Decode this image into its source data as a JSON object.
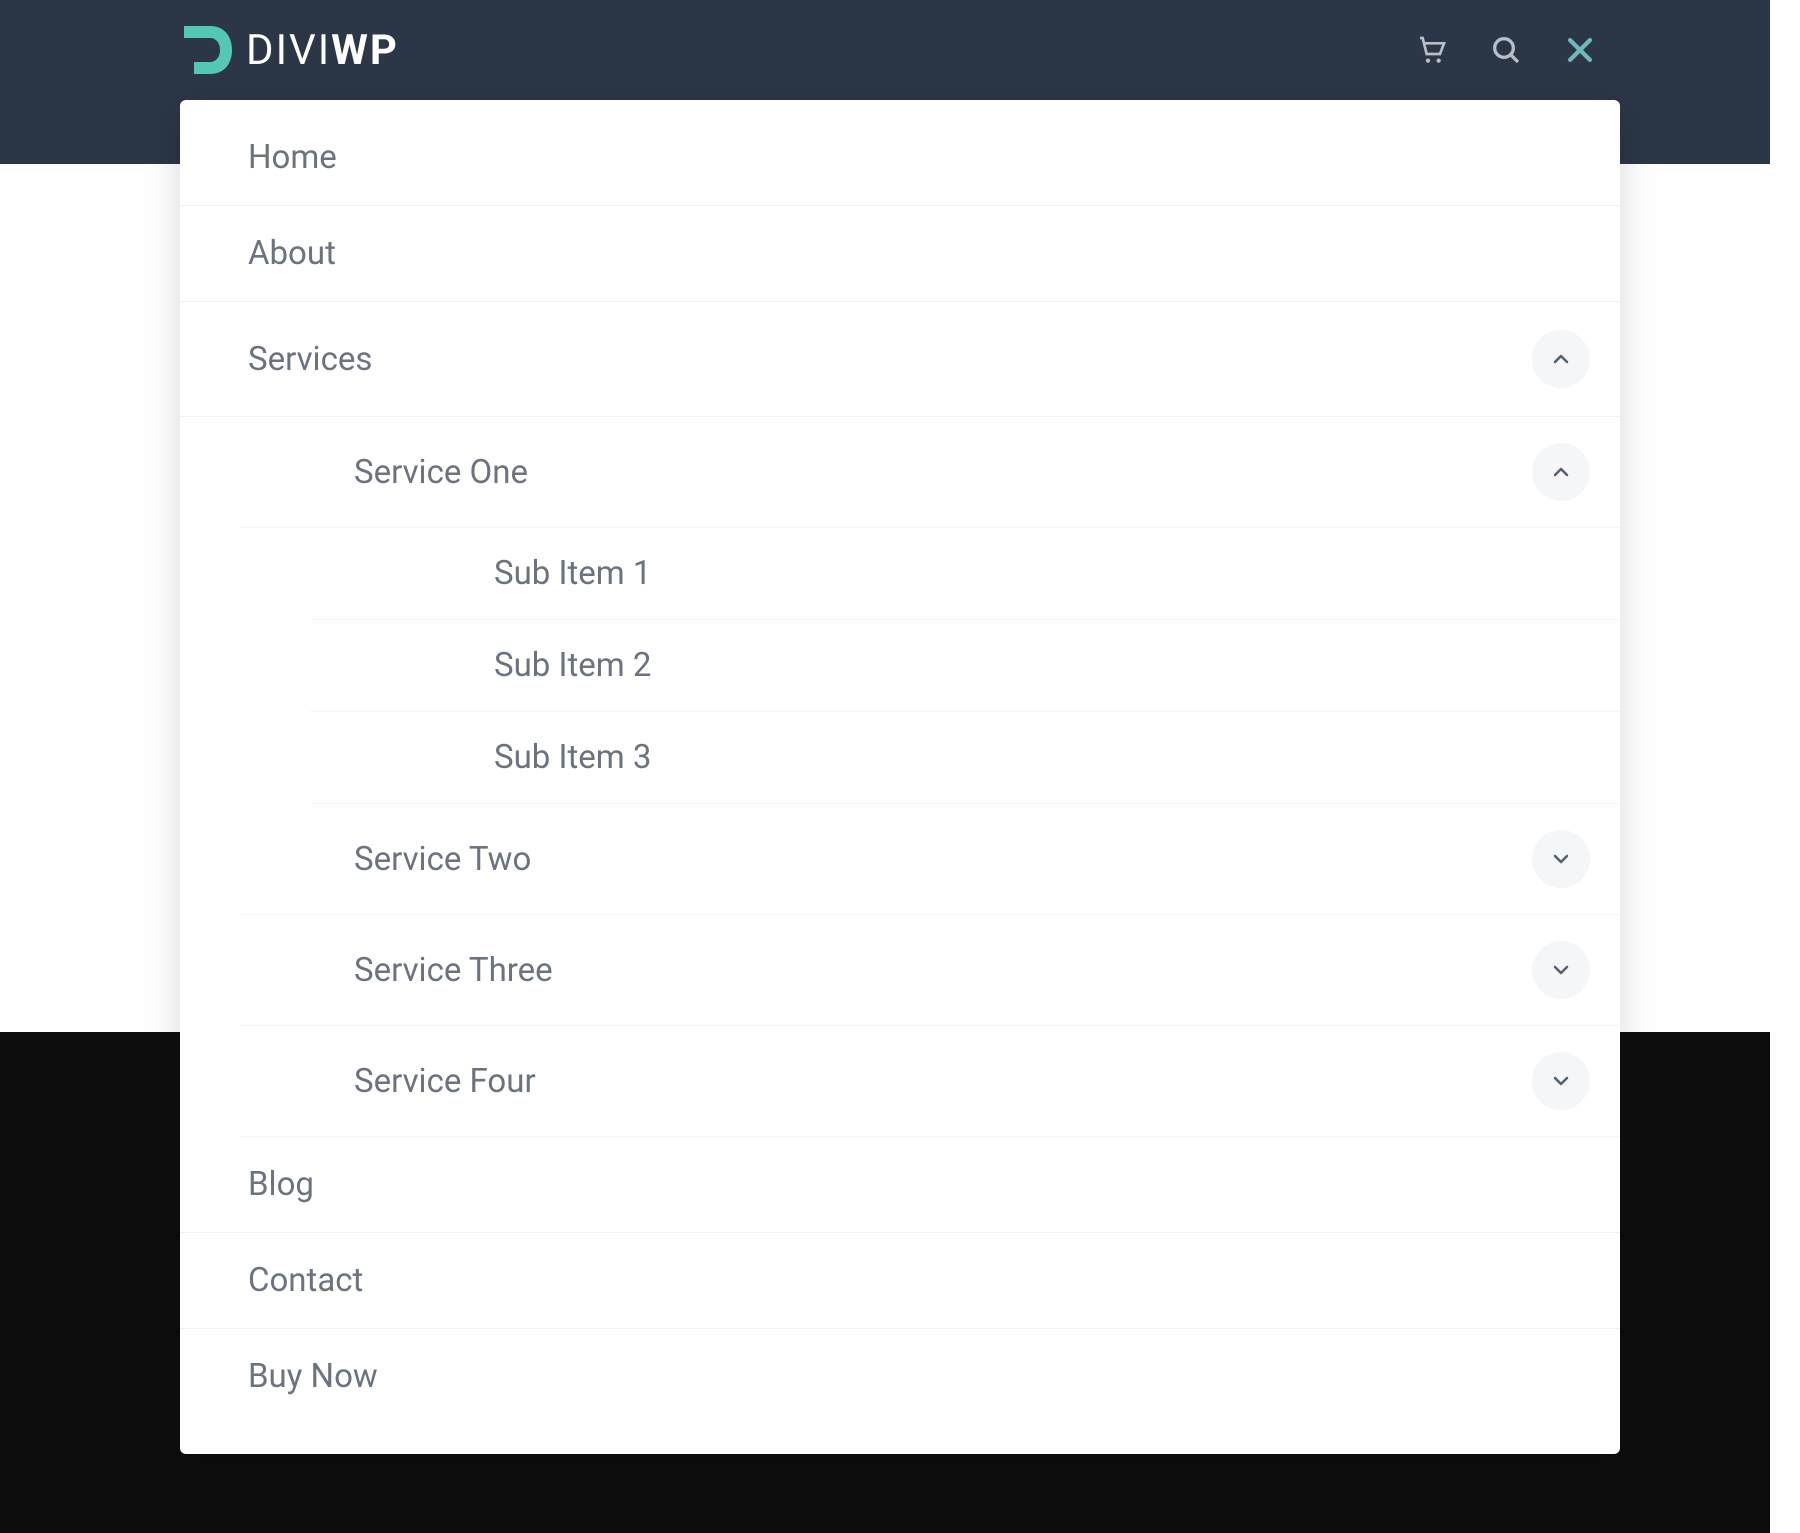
{
  "logo": {
    "text1": "DIVI",
    "text2": "WP"
  },
  "menu": {
    "home": "Home",
    "about": "About",
    "services": "Services",
    "service_one": "Service One",
    "sub1": "Sub Item 1",
    "sub2": "Sub Item 2",
    "sub3": "Sub Item 3",
    "service_two": "Service Two",
    "service_three": "Service Three",
    "service_four": "Service Four",
    "blog": "Blog",
    "contact": "Contact",
    "buy_now": "Buy Now"
  },
  "colors": {
    "header_bg": "#2b3647",
    "accent": "#53c9b5",
    "icon_gray": "#b9bec7",
    "text_gray": "#6b7280",
    "toggle_bg": "#f5f6f7",
    "footer_bg": "#0d0d0d"
  }
}
